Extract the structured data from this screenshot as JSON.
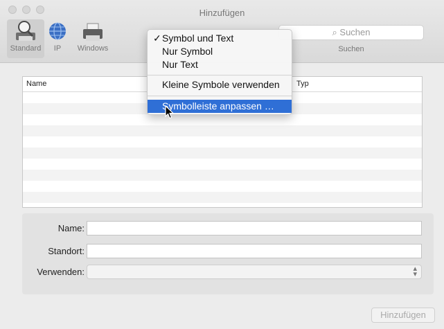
{
  "window": {
    "title": "Hinzufügen"
  },
  "toolbar": {
    "items": [
      {
        "label": "Standard",
        "icon": "standard-printer-magnifier-icon",
        "selected": true
      },
      {
        "label": "IP",
        "icon": "globe-icon",
        "selected": false
      },
      {
        "label": "Windows",
        "icon": "windows-printer-icon",
        "selected": false
      }
    ],
    "search_placeholder": "Suchen",
    "search_label": "Suchen"
  },
  "table": {
    "columns": [
      "Name",
      "Typ"
    ],
    "rows": []
  },
  "form": {
    "name_label": "Name:",
    "name_value": "",
    "location_label": "Standort:",
    "location_value": "",
    "use_label": "Verwenden:",
    "use_value": ""
  },
  "add_button": "Hinzufügen",
  "context_menu": {
    "items": [
      {
        "label": "Symbol und Text",
        "checked": true
      },
      {
        "label": "Nur Symbol",
        "checked": false
      },
      {
        "label": "Nur Text",
        "checked": false
      },
      {
        "label": "Kleine Symbole verwenden",
        "checked": false
      },
      {
        "label": "Symbolleiste anpassen …",
        "checked": false,
        "highlighted": true
      }
    ],
    "check_glyph": "✓"
  },
  "colors": {
    "highlight": "#2f6fd6"
  }
}
